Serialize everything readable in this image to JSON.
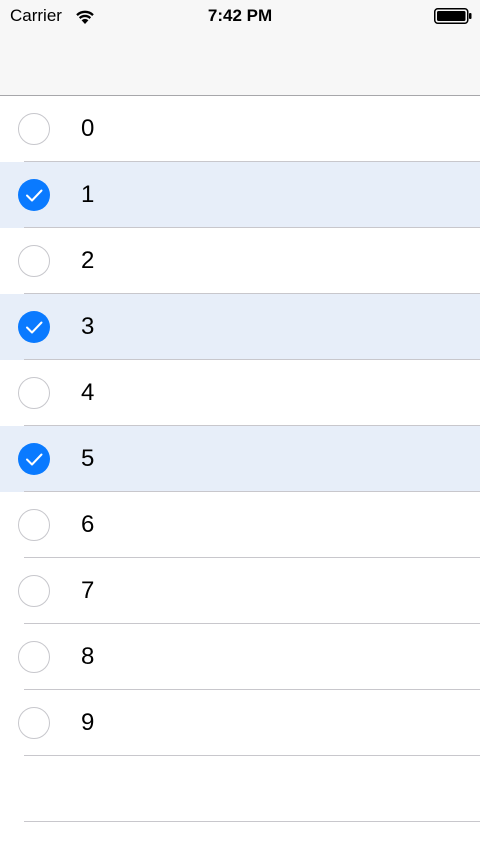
{
  "status_bar": {
    "carrier": "Carrier",
    "time": "7:42 PM",
    "wifi_icon": "wifi-icon",
    "battery_icon": "battery-icon"
  },
  "colors": {
    "accent": "#0a7aff",
    "selected_row_bg": "#e7eef9",
    "separator": "#c8c7cc"
  },
  "list": {
    "items": [
      {
        "label": "0",
        "selected": false
      },
      {
        "label": "1",
        "selected": true
      },
      {
        "label": "2",
        "selected": false
      },
      {
        "label": "3",
        "selected": true
      },
      {
        "label": "4",
        "selected": false
      },
      {
        "label": "5",
        "selected": true
      },
      {
        "label": "6",
        "selected": false
      },
      {
        "label": "7",
        "selected": false
      },
      {
        "label": "8",
        "selected": false
      },
      {
        "label": "9",
        "selected": false
      }
    ]
  }
}
